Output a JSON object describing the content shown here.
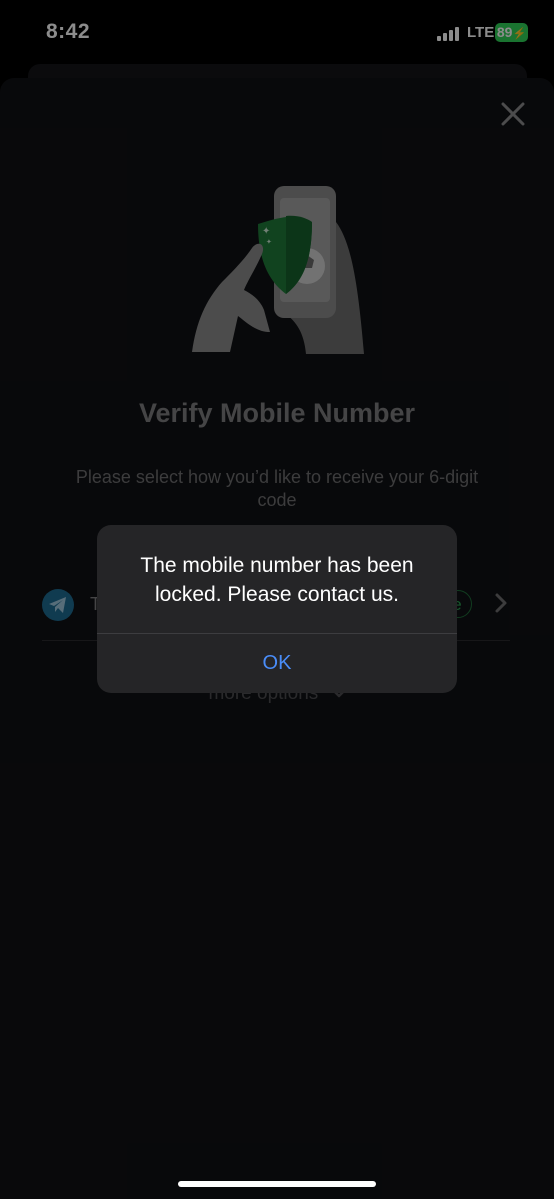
{
  "status_bar": {
    "time": "8:42",
    "network": "LTE",
    "battery": "89"
  },
  "screen": {
    "title": "Verify Mobile Number",
    "subtitle": "Please select how you’d like to receive your 6-digit code",
    "options": [
      {
        "label": "T",
        "icon": "telegram-icon",
        "badge": "e"
      }
    ],
    "more_options": "more options"
  },
  "alert": {
    "message": "The mobile number has been locked. Please contact us.",
    "ok_label": "OK"
  },
  "colors": {
    "background": "#101114",
    "alert_background": "#252527",
    "link_blue": "#4a8df8",
    "shield_green": "#1f7a3a",
    "battery_green": "#30d158"
  }
}
